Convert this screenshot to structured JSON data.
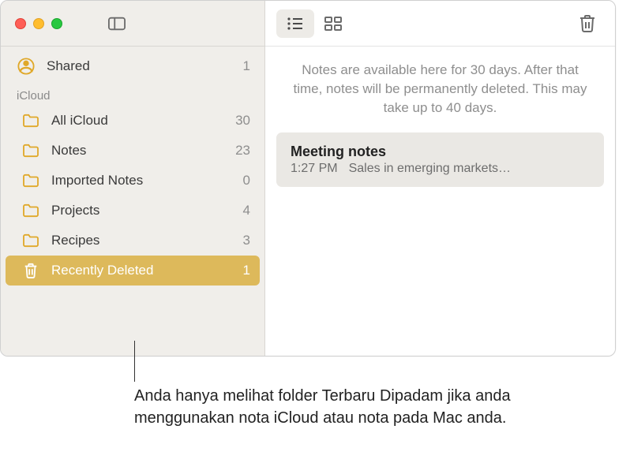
{
  "sidebar": {
    "shared": {
      "label": "Shared",
      "count": "1"
    },
    "section": "iCloud",
    "folders": [
      {
        "label": "All iCloud",
        "count": "30"
      },
      {
        "label": "Notes",
        "count": "23"
      },
      {
        "label": "Imported Notes",
        "count": "0"
      },
      {
        "label": "Projects",
        "count": "4"
      },
      {
        "label": "Recipes",
        "count": "3"
      }
    ],
    "recently_deleted": {
      "label": "Recently Deleted",
      "count": "1"
    }
  },
  "main": {
    "banner": "Notes are available here for 30 days. After that time, notes will be permanently deleted. This may take up to 40 days.",
    "note": {
      "title": "Meeting notes",
      "time": "1:27 PM",
      "preview": "Sales in emerging markets…"
    }
  },
  "callout": "Anda hanya melihat folder Terbaru Dipadam jika anda menggunakan nota iCloud atau nota pada Mac anda."
}
